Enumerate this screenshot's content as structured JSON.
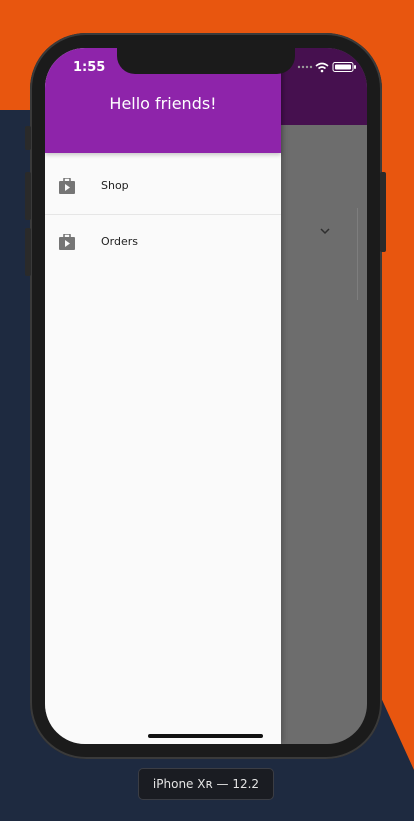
{
  "status_bar": {
    "time": "1:55"
  },
  "drawer": {
    "header_title": "Hello friends!",
    "items": [
      {
        "label": "Shop",
        "icon": "shop-icon"
      },
      {
        "label": "Orders",
        "icon": "shop-icon"
      }
    ]
  },
  "device": {
    "label": "iPhone Xʀ — 12.2"
  },
  "colors": {
    "drawer_header": "#8e24aa",
    "appbar": "#46104f",
    "background_orange": "#e8560f",
    "background_navy": "#1e2a40"
  }
}
